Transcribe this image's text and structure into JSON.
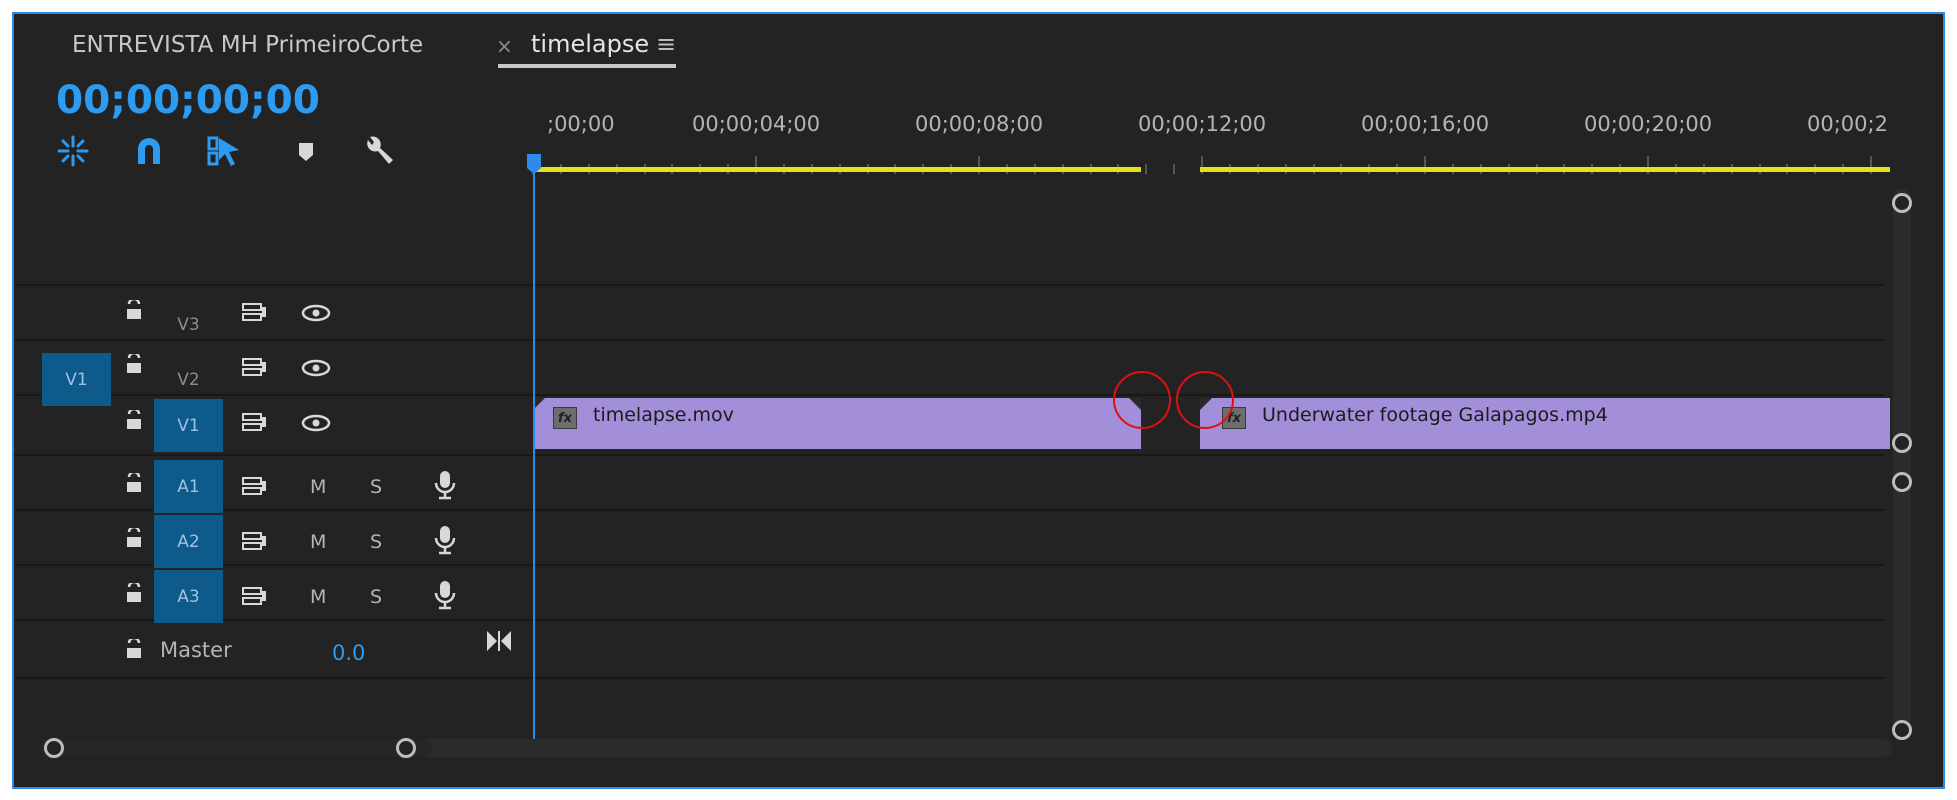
{
  "tabs": {
    "inactive_label": "ENTREVISTA MH PrimeiroCorte",
    "active_close": "×",
    "active_label": "timelapse",
    "menu_glyph": "≡"
  },
  "timecode": "00;00;00;00",
  "toolbar": {
    "icons": [
      "nest-sequence-icon",
      "snap-magnet-icon",
      "linked-selection-icon",
      "add-marker-icon",
      "wrench-settings-icon"
    ]
  },
  "ruler": {
    "labels": [
      ";00;00",
      "00;00;04;00",
      "00;00;08;00",
      "00;00;12;00",
      "00;00;16;00",
      "00;00;20;00",
      "00;00;2"
    ]
  },
  "tracks": {
    "video": [
      {
        "name": "V3",
        "target_active": false,
        "source": ""
      },
      {
        "name": "V2",
        "target_active": false,
        "source": "V1"
      },
      {
        "name": "V1",
        "target_active": true,
        "source": ""
      }
    ],
    "audio": [
      {
        "name": "A1",
        "mute": "M",
        "solo": "S"
      },
      {
        "name": "A2",
        "mute": "M",
        "solo": "S"
      },
      {
        "name": "A3",
        "mute": "M",
        "solo": "S"
      }
    ],
    "master_label": "Master",
    "master_value": "0.0"
  },
  "clips": [
    {
      "name": "timelapse.mov",
      "fx": "fx"
    },
    {
      "name": "Underwater footage Galapagos.mp4",
      "fx": "fx"
    }
  ],
  "colors": {
    "accent": "#2d9bf0",
    "clip": "#a38fd9",
    "in_out_bar": "#e6e01a",
    "annotation": "#e01010",
    "track_target": "#0e5a8a"
  }
}
